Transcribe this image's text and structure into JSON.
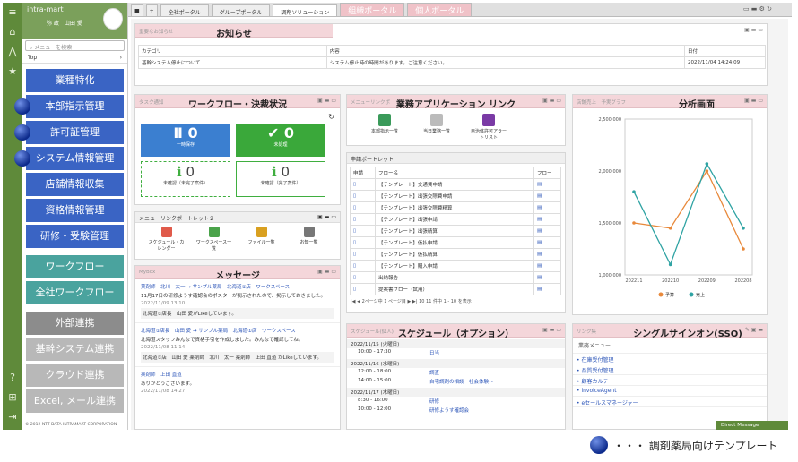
{
  "rail": {
    "icons": [
      "menu-icon",
      "home-icon",
      "chart-icon",
      "star-icon",
      "help-icon",
      "sitemap-icon",
      "logout-icon"
    ]
  },
  "sidebar": {
    "logo": "intra-mart",
    "user": "弥 政　山田 愛",
    "search_placeholder": "メニューを検索",
    "top_label": "Top",
    "buttons": [
      {
        "label": "業種特化",
        "style": "blue",
        "dot": false
      },
      {
        "label": "本部指示管理",
        "style": "blue",
        "dot": true
      },
      {
        "label": "許可証管理",
        "style": "blue",
        "dot": true
      },
      {
        "label": "システム情報管理",
        "style": "blue",
        "dot": true
      },
      {
        "label": "店舗情報収集",
        "style": "blue",
        "dot": false
      },
      {
        "label": "資格情報管理",
        "style": "blue",
        "dot": false
      },
      {
        "label": "研修・受験管理",
        "style": "blue",
        "dot": false
      },
      {
        "label": "ワークフロー",
        "style": "teal",
        "dot": false
      },
      {
        "label": "全社ワークフロー",
        "style": "teal",
        "dot": false
      },
      {
        "label": "外部連携",
        "style": "gray",
        "dot": false
      },
      {
        "label": "基幹システム連携",
        "style": "lgray",
        "dot": false
      },
      {
        "label": "クラウド連携",
        "style": "lgray",
        "dot": false
      },
      {
        "label": "Excel, メール連携",
        "style": "lgray",
        "dot": false
      }
    ],
    "copyright": "© 2012 NTT DATA INTRAMART CORPORATION"
  },
  "tabs": [
    "全社ポータル",
    "グループポータル",
    "調剤ソリューション",
    "組織ポータル",
    "個人ポータル"
  ],
  "notice": {
    "sub": "重要なお知らせ",
    "title": "お知らせ",
    "cols": [
      "カテゴリ",
      "内容",
      "日付"
    ],
    "row": [
      "基幹システム停止について",
      "システム停止時の時間があります。ご注意ください。",
      "2022/11/04 14:24:09"
    ]
  },
  "workflow": {
    "sub": "タスク通知",
    "title": "ワークフロー・決裁状況",
    "tiles": [
      {
        "num": "0",
        "label": "一時保存"
      },
      {
        "num": "0",
        "label": "未処理"
      },
      {
        "num": "0",
        "label": "未確認（未完了案件）"
      },
      {
        "num": "0",
        "label": "未確認（完了案件）"
      }
    ]
  },
  "menu_portlet": {
    "title": "メニューリンクポートレット２",
    "items": [
      "スケジュール・カレンダー",
      "ワークスペース一覧",
      "ファイル一覧",
      "お知一覧"
    ]
  },
  "message": {
    "sub": "MyBox",
    "title": "メッセージ",
    "posts": [
      {
        "head": "薬剤師　北川　太一 → サンプル薬局　北海道①店　ワークスペース",
        "body": "11月17日の研修ようす確認会のポスターが掲示されたので、掲示しておきました。",
        "date": "2022/11/09 13:10",
        "foot": "北海道①店長　山田 愛がLikeしています。"
      },
      {
        "head": "北海道①店長　山田 愛 → サンプル薬局　北海道①店　ワークスペース",
        "body": "北海道スタッフみんなで資格手引を作成しました。みんなで確認してね。",
        "date": "2022/11/08 11:14",
        "foot": "北海道①店　山田 愛 薬剤師　北川　太一 薬剤師　上田 直道 がLikeしています。"
      },
      {
        "head": "薬剤師　上田 直道",
        "body": "ありがとうございます。",
        "date": "2022/11/08 14:27",
        "foot": ""
      }
    ]
  },
  "bizapp": {
    "sub": "メニューリンクポ",
    "title": "業務アプリケーション リンク",
    "items": [
      "本部指示一覧",
      "当日業務一覧",
      "自治体許可アラートリスト"
    ]
  },
  "apply": {
    "title": "申請ポートレット",
    "cols": [
      "申請",
      "フロー名",
      "フロー"
    ],
    "rows": [
      "【テンプレート】交通費申請",
      "【テンプレート】出張交際費申請",
      "【テンプレート】出張交際費精算",
      "【テンプレート】出張申請",
      "【テンプレート】出張精算",
      "【テンプレート】仮払申請",
      "【テンプレート】仮払精算",
      "【テンプレート】購入申請",
      "出納報告",
      "提案書フロー（試用）"
    ],
    "pager": "2ページ中 1 ページ目",
    "per": "10",
    "count": "11 件中 1 - 10 を表示"
  },
  "schedule": {
    "sub": "スケジュール(個人)",
    "title": "スケジュール（オプション）",
    "days": [
      {
        "date": "2022/11/15 (火曜日)",
        "items": [
          {
            "time": "10:00 - 17:30",
            "text": "日当"
          }
        ]
      },
      {
        "date": "2022/11/16 (水曜日)",
        "items": [
          {
            "time": "12:00 - 18:00",
            "text": "調査"
          },
          {
            "time": "14:00 - 15:00",
            "text": "自宅調剤の相談　社会体験～"
          }
        ]
      },
      {
        "date": "2022/11/17 (木曜日)",
        "items": [
          {
            "time": "8:30 - 16:00",
            "text": "研修"
          },
          {
            "time": "10:00 - 12:00",
            "text": "研修ようす確認会"
          }
        ]
      }
    ]
  },
  "analysis": {
    "sub": "店舗売上　予実グラフ",
    "title": "分析画面",
    "legend": [
      "予算",
      "売上"
    ]
  },
  "chart_data": {
    "type": "line",
    "categories": [
      "202211",
      "202210",
      "202209",
      "202208"
    ],
    "series": [
      {
        "name": "予算",
        "values": [
          1500000,
          1450000,
          2000000,
          1250000
        ],
        "color": "#e8893b"
      },
      {
        "name": "売上",
        "values": [
          1800000,
          1100000,
          2070000,
          1450000
        ],
        "color": "#2fa3a3"
      }
    ],
    "ylim": [
      1000000,
      2500000
    ],
    "yticks": [
      "2,500,000",
      "2,000,000",
      "1,500,000",
      "1,000,000"
    ]
  },
  "sso": {
    "sub": "リンク集",
    "title": "シングルサインオン(SSO)",
    "header": "業務メニュー",
    "links": [
      "在庫受付管理",
      "品質受付管理",
      "顧客カルテ",
      "invoiceAgent",
      "eセールスマネージャー"
    ]
  },
  "direct_message": "Direct Message",
  "legend_note": "・・・ 調剤薬局向けテンプレート"
}
